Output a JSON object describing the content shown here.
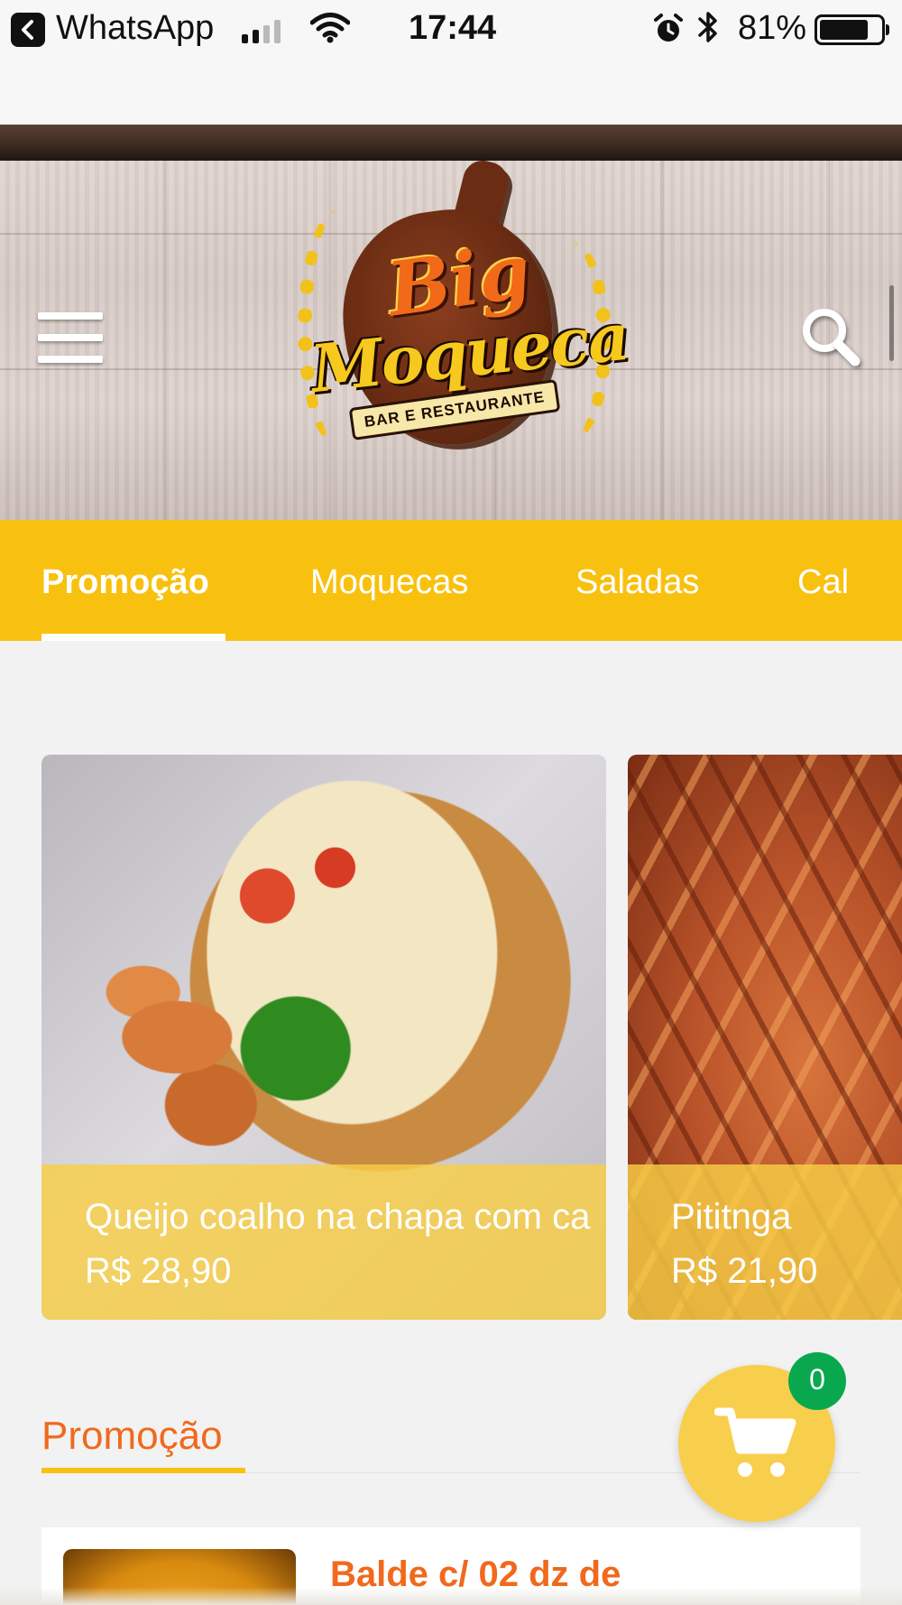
{
  "status_bar": {
    "back_app": "WhatsApp",
    "time": "17:44",
    "battery": "81%",
    "battery_level": 0.81
  },
  "header": {
    "logo": {
      "line1": "Big",
      "line2": "Moqueca",
      "line3": "BAR E RESTAURANTE"
    },
    "menu_icon": "hamburger-menu-icon",
    "search_icon": "search-icon"
  },
  "tabs": [
    {
      "label": "Promoção",
      "active": true
    },
    {
      "label": "Moquecas",
      "active": false
    },
    {
      "label": "Saladas",
      "active": false
    },
    {
      "label": "Cal",
      "active": false
    }
  ],
  "featured": [
    {
      "title": "Queijo coalho na chapa com ca",
      "price": "R$ 28,90"
    },
    {
      "title": "Pititnga",
      "price": "R$ 21,90"
    }
  ],
  "section": {
    "title": "Promoção"
  },
  "list": [
    {
      "title": "Balde c/ 02 dz de"
    }
  ],
  "cart": {
    "count": "0",
    "icon": "shopping-cart-icon"
  },
  "colors": {
    "accent_yellow": "#f8c10f",
    "accent_orange": "#f0691d",
    "badge_green": "#0aa84e"
  }
}
